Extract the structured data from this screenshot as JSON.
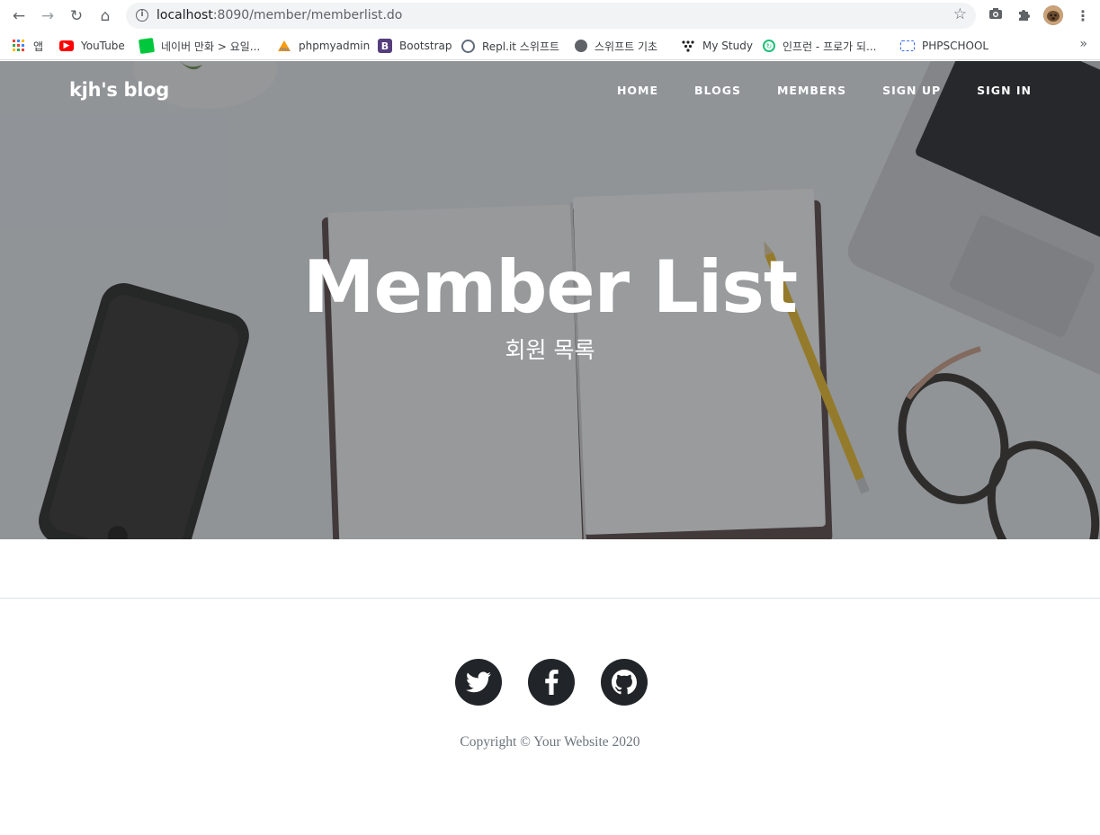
{
  "browser": {
    "url_host": "localhost",
    "url_path": ":8090/member/memberlist.do",
    "bookmarks": [
      {
        "label": "앱",
        "icon": "apps-grid-icon"
      },
      {
        "label": "YouTube",
        "icon": "youtube-icon"
      },
      {
        "label": "네이버 만화 > 요일...",
        "icon": "naver-webtoon-icon"
      },
      {
        "label": "phpmyadmin",
        "icon": "phpmyadmin-icon"
      },
      {
        "label": "Bootstrap",
        "icon": "bootstrap-icon"
      },
      {
        "label": "Repl.it 스위프트",
        "icon": "replit-icon"
      },
      {
        "label": "스위프트 기초",
        "icon": "globe-icon"
      },
      {
        "label": "My Study",
        "icon": "mystudy-icon"
      },
      {
        "label": "인프런 - 프로가 되...",
        "icon": "inflearn-icon"
      },
      {
        "label": "PHPSCHOOL",
        "icon": "phpschool-icon"
      }
    ],
    "more": "»"
  },
  "site": {
    "brand": "kjh's blog",
    "nav": [
      "HOME",
      "BLOGS",
      "MEMBERS",
      "SIGN UP",
      "SIGN IN"
    ],
    "hero_title": "Member List",
    "hero_subtitle": "회원 목록"
  },
  "footer": {
    "social": [
      "twitter-icon",
      "facebook-icon",
      "github-icon"
    ],
    "copyright": "Copyright © Your Website 2020"
  }
}
